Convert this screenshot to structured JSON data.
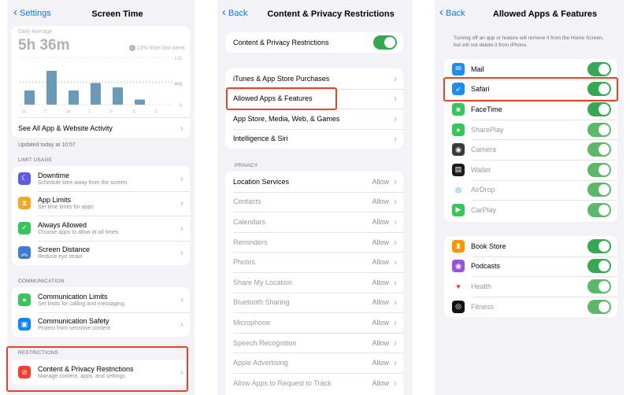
{
  "screen_time": {
    "back_label": "Settings",
    "title": "Screen Time",
    "daily_label": "Daily Average",
    "daily_value": "5h 36m",
    "trend": "13% from last week",
    "chart_y_labels": [
      "12h",
      "avg",
      "0"
    ],
    "chart_days": [
      "M",
      "T",
      "W",
      "T",
      "F",
      "S",
      "S"
    ],
    "chart_values": [
      3.6,
      8.6,
      3.6,
      5.5,
      4.4,
      1.3,
      0
    ],
    "see_all": "See All App & Website Activity",
    "updated": "Updated today at 10:57",
    "limit_usage_header": "LIMIT USAGE",
    "limit_items": [
      {
        "title": "Downtime",
        "subtitle": "Schedule time away from the screen",
        "color": "#5e5ce6",
        "icon": "moon-icon"
      },
      {
        "title": "App Limits",
        "subtitle": "Set time limits for apps",
        "color": "#f5a623",
        "icon": "hourglass-icon"
      },
      {
        "title": "Always Allowed",
        "subtitle": "Choose apps to allow at all times",
        "color": "#34c759",
        "icon": "checkmark-icon"
      },
      {
        "title": "Screen Distance",
        "subtitle": "Reduce eye strain",
        "color": "#3d7bd9",
        "icon": "chevrons-up-icon"
      }
    ],
    "communication_header": "COMMUNICATION",
    "communication_items": [
      {
        "title": "Communication Limits",
        "subtitle": "Set limits for calling and messaging",
        "color": "#34c759",
        "icon": "person-icon"
      },
      {
        "title": "Communication Safety",
        "subtitle": "Protect from sensitive content",
        "color": "#0a84ff",
        "icon": "chat-icon"
      }
    ],
    "restrictions_header": "RESTRICTIONS",
    "restrictions_item": {
      "title": "Content & Privacy Restrictions",
      "subtitle": "Manage content, apps, and settings",
      "color": "#ff3b30",
      "icon": "no-entry-icon"
    }
  },
  "content_privacy": {
    "back_label": "Back",
    "title": "Content & Privacy Restrictions",
    "master_toggle_label": "Content & Privacy Restrictions",
    "master_toggle_on": true,
    "store_items": [
      "iTunes & App Store Purchases",
      "Allowed Apps & Features",
      "App Store, Media, Web, & Games",
      "Intelligence & Siri"
    ],
    "privacy_header": "PRIVACY",
    "privacy_items": [
      {
        "label": "Location Services",
        "value": "Allow"
      },
      {
        "label": "Contacts",
        "value": "Allow"
      },
      {
        "label": "Calendars",
        "value": "Allow"
      },
      {
        "label": "Reminders",
        "value": "Allow"
      },
      {
        "label": "Photos",
        "value": "Allow"
      },
      {
        "label": "Share My Location",
        "value": "Allow"
      },
      {
        "label": "Bluetooth Sharing",
        "value": "Allow"
      },
      {
        "label": "Microphone",
        "value": "Allow"
      },
      {
        "label": "Speech Recognition",
        "value": "Allow"
      },
      {
        "label": "Apple Advertising",
        "value": "Allow"
      },
      {
        "label": "Allow Apps to Request to Track",
        "value": "Allow"
      }
    ]
  },
  "allowed_apps": {
    "back_label": "Back",
    "title": "Allowed Apps & Features",
    "note": "Turning off an app or feature will remove it from the Home Screen, but will not delete it from iPhone.",
    "group1": [
      {
        "label": "Mail",
        "color": "#1e8cf0",
        "icon": "mail-icon",
        "glyph": "✉"
      },
      {
        "label": "Safari",
        "color": "#1e8cf0",
        "icon": "compass-icon",
        "glyph": "➶"
      },
      {
        "label": "FaceTime",
        "color": "#34c759",
        "icon": "video-icon",
        "glyph": "■"
      },
      {
        "label": "SharePlay",
        "color": "#34c759",
        "icon": "shareplay-icon",
        "glyph": "●"
      },
      {
        "label": "Camera",
        "color": "#3a3a3c",
        "icon": "camera-icon",
        "glyph": "◉"
      },
      {
        "label": "Wallet",
        "color": "#1c1c1e",
        "icon": "wallet-icon",
        "glyph": "▤"
      },
      {
        "label": "AirDrop",
        "color": "#ffffff",
        "icon": "airdrop-icon",
        "glyph": "◎"
      },
      {
        "label": "CarPlay",
        "color": "#34c759",
        "icon": "carplay-icon",
        "glyph": "▶"
      }
    ],
    "group2": [
      {
        "label": "Book Store",
        "color": "#ff9500",
        "icon": "book-icon",
        "glyph": "▮"
      },
      {
        "label": "Podcasts",
        "color": "#9b51e0",
        "icon": "podcast-icon",
        "glyph": "◉"
      },
      {
        "label": "Health",
        "color": "#ffffff",
        "icon": "heart-icon",
        "glyph": "♥"
      },
      {
        "label": "Fitness",
        "color": "#111111",
        "icon": "rings-icon",
        "glyph": "◎"
      }
    ]
  }
}
